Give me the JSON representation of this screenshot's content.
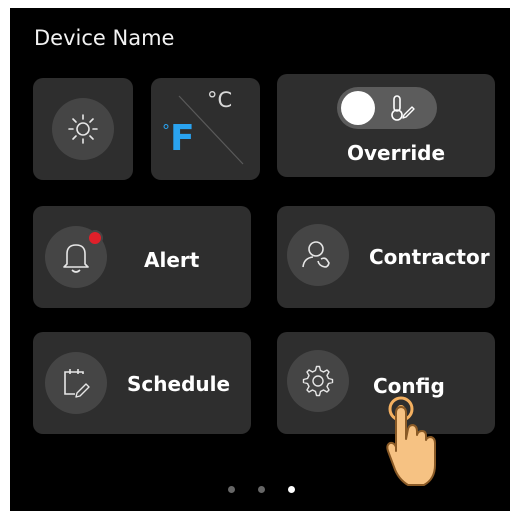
{
  "header": {
    "title": "Device Name"
  },
  "tiles": {
    "brightness": {
      "icon": "brightness-icon"
    },
    "unit": {
      "celsius": "°C",
      "fahrenheit": "°F",
      "active": "F"
    },
    "override": {
      "label": "Override",
      "toggle_on": true,
      "icon": "thermometer-edit-icon"
    },
    "alert": {
      "label": "Alert",
      "icon": "bell-alert-icon",
      "has_notification": true
    },
    "contractor": {
      "label": "Contractor",
      "icon": "contractor-phone-icon"
    },
    "schedule": {
      "label": "Schedule",
      "icon": "calendar-edit-icon"
    },
    "config": {
      "label": "Config",
      "icon": "gear-icon"
    }
  },
  "pagination": {
    "total": 3,
    "current": 3
  },
  "colors": {
    "background": "#000000",
    "tile": "#2e2e2e",
    "icon_circle": "#454545",
    "fahrenheit_accent": "#2aa3f0",
    "alert_dot": "#e0202a",
    "hand": "#f4b060"
  }
}
